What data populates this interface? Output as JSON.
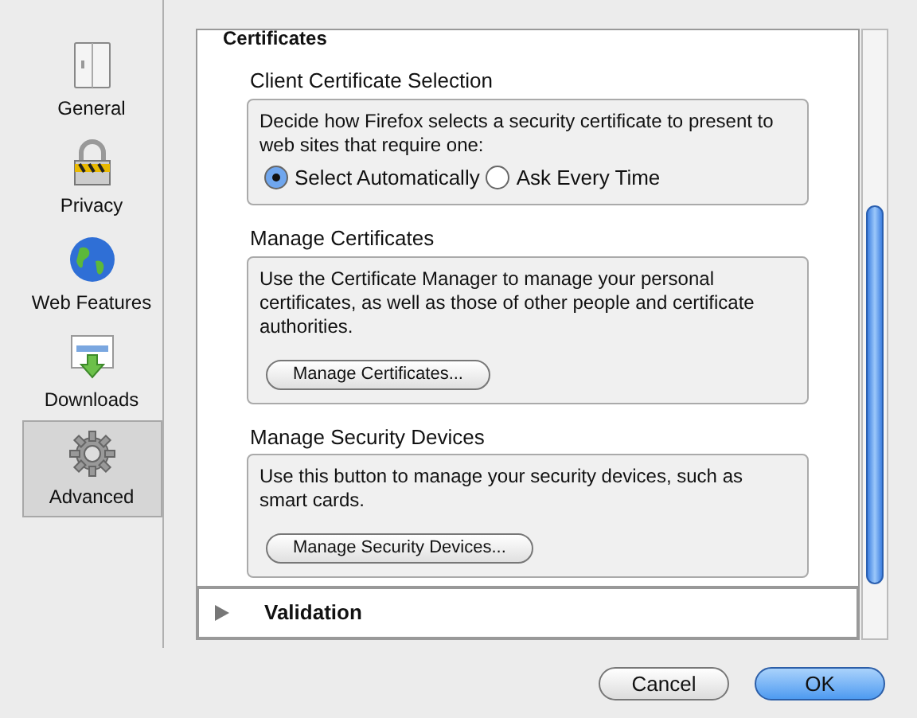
{
  "sidebar": {
    "items": [
      {
        "label": "General",
        "kind": "general",
        "selected": false
      },
      {
        "label": "Privacy",
        "kind": "privacy",
        "selected": false
      },
      {
        "label": "Web Features",
        "kind": "web",
        "selected": false
      },
      {
        "label": "Downloads",
        "kind": "downloads",
        "selected": false
      },
      {
        "label": "Advanced",
        "kind": "advanced",
        "selected": true
      }
    ]
  },
  "sections": [
    {
      "title": "Certificates",
      "expanded": true,
      "groups": [
        {
          "title": "Client Certificate Selection",
          "description": "Decide how Firefox selects a security certificate to present to web sites that require one:",
          "radios": [
            {
              "label": "Select Automatically",
              "selected": true
            },
            {
              "label": "Ask Every Time",
              "selected": false
            }
          ]
        },
        {
          "title": "Manage Certificates",
          "description": "Use the Certificate Manager to manage your personal certificates, as well as those of other people and certificate authorities.",
          "button": "Manage Certificates..."
        },
        {
          "title": "Manage Security Devices",
          "description": "Use this button to manage your security devices, such as smart cards.",
          "button": "Manage Security Devices..."
        }
      ]
    },
    {
      "title": "Validation",
      "expanded": false
    }
  ],
  "buttons": [
    {
      "label": "Cancel",
      "default": false
    },
    {
      "label": "OK",
      "default": true
    }
  ]
}
